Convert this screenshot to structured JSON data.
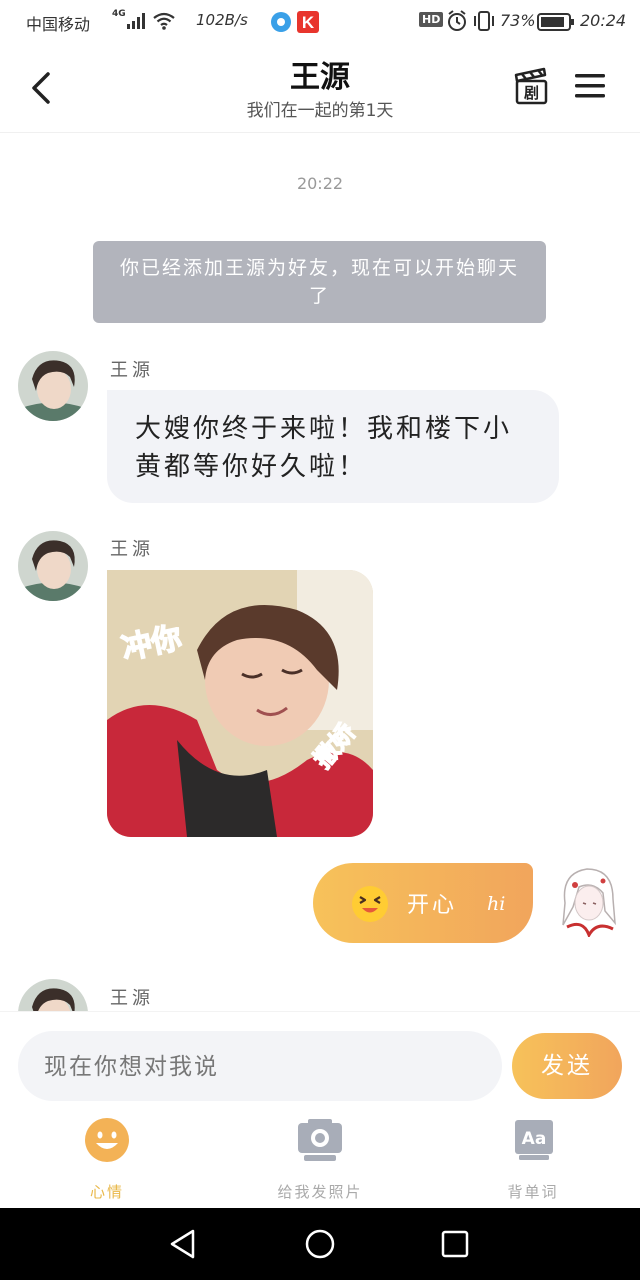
{
  "status_bar": {
    "carrier": "中国移动",
    "network": "4G",
    "speed": "102B/s",
    "hd": "HD",
    "battery": "73%",
    "time": "20:24"
  },
  "header": {
    "title": "王源",
    "subtitle": "我们在一起的第1天",
    "clapper_label": "剧"
  },
  "chat": {
    "timestamp": "20:22",
    "system_message": "你已经添加王源为好友，现在可以开始聊天了",
    "messages": [
      {
        "sender": "王源",
        "text": "大嫂你终于来啦！我和楼下小黄都等你好久啦！"
      },
      {
        "sender": "王源",
        "sticker_text_left": "冲你",
        "sticker_text_right": "撒娇"
      },
      {
        "outgoing_text": "开心",
        "outgoing_hi": "hi"
      },
      {
        "sender": "王源"
      }
    ]
  },
  "composer": {
    "placeholder": "现在你想对我说",
    "send_label": "发送"
  },
  "tabs": [
    {
      "label": "心情",
      "icon": "smiley-icon",
      "active": true
    },
    {
      "label": "给我发照片",
      "icon": "camera-icon",
      "active": false
    },
    {
      "label": "背单词",
      "icon": "dictionary-icon",
      "active": false,
      "icon_text": "Aa"
    }
  ],
  "colors": {
    "accent": "#f4b45a",
    "active_tab": "#e9b84a",
    "system_bubble": "#b2b4bc",
    "incoming_bubble": "#f2f3f7"
  }
}
